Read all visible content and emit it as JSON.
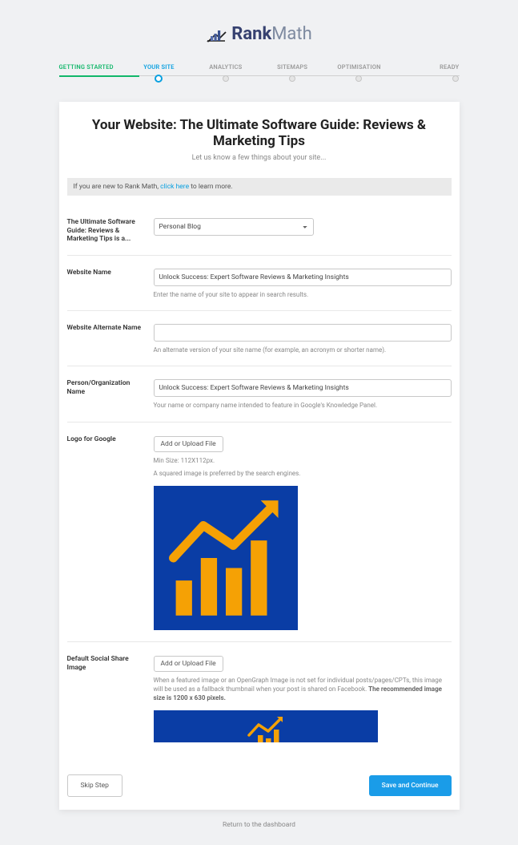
{
  "brand": {
    "part1": "Rank",
    "part2": "Math"
  },
  "stepper": {
    "items": [
      {
        "label": "GETTING STARTED",
        "state": "done"
      },
      {
        "label": "YOUR SITE",
        "state": "active"
      },
      {
        "label": "ANALYTICS",
        "state": "pending"
      },
      {
        "label": "SITEMAPS",
        "state": "pending"
      },
      {
        "label": "OPTIMISATION",
        "state": "pending"
      },
      {
        "label": "READY",
        "state": "pending"
      }
    ]
  },
  "header": {
    "title": "Your Website: The Ultimate Software Guide: Reviews & Marketing Tips",
    "subtitle": "Let us know a few things about your site..."
  },
  "notice": {
    "prefix": "If you are new to Rank Math, ",
    "link": "click here",
    "suffix": " to learn more."
  },
  "fields": {
    "siteType": {
      "label": "The Ultimate Software Guide: Reviews & Marketing Tips is a...",
      "value": "Personal Blog"
    },
    "siteName": {
      "label": "Website Name",
      "value": "Unlock Success: Expert Software Reviews & Marketing Insights",
      "help": "Enter the name of your site to appear in search results."
    },
    "altName": {
      "label": "Website Alternate Name",
      "value": "",
      "help": "An alternate version of your site name (for example, an acronym or shorter name)."
    },
    "personOrg": {
      "label": "Person/Organization Name",
      "value": "Unlock Success: Expert Software Reviews & Marketing Insights",
      "help": "Your name or company name intended to feature in Google's Knowledge Panel."
    },
    "logo": {
      "label": "Logo for Google",
      "button": "Add or Upload File",
      "help1": "Min Size: 112X112px.",
      "help2": "A squared image is preferred by the search engines."
    },
    "social": {
      "label": "Default Social Share Image",
      "button": "Add or Upload File",
      "help_prefix": "When a featured image or an OpenGraph Image is not set for individual posts/pages/CPTs, this image will be used as a fallback thumbnail when your post is shared on Facebook. ",
      "help_bold": "The recommended image size is 1200 x 630 pixels."
    }
  },
  "footer": {
    "skip": "Skip Step",
    "save": "Save and Continue",
    "dashboard": "Return to the dashboard"
  }
}
